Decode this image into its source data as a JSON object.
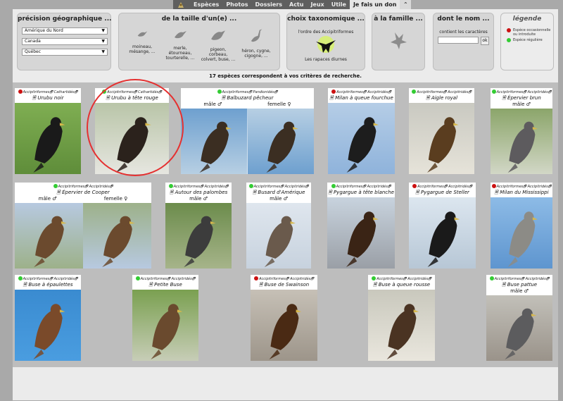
{
  "nav": {
    "items": [
      "Espèces",
      "Photos",
      "Dossiers",
      "Actu",
      "Jeux",
      "Utile",
      "Je fais un don"
    ],
    "collapse_glyph": "⌃"
  },
  "filters": {
    "geo": {
      "title": "précision géographique ...",
      "selects": [
        "Amérique du Nord",
        "Canada",
        "Québec"
      ]
    },
    "size": {
      "title": "de la taille d'un(e) ...",
      "options": [
        {
          "label": "moineau, mésange, ..."
        },
        {
          "label": "merle, étourneau, tourterelle, ..."
        },
        {
          "label": "pigeon, corbeau, colvert, buse, ..."
        },
        {
          "label": "héron, cygne, cigogne, ..."
        }
      ]
    },
    "taxo": {
      "title": "choix taxonomique ...",
      "line1": "l'ordre des Accipitriformes",
      "line2": "Les rapaces diurnes"
    },
    "family": {
      "title": "à la famille ..."
    },
    "name": {
      "title": "dont le nom ...",
      "label": "contient les caractères",
      "ok": "ok"
    },
    "legend": {
      "title": "légende",
      "items": [
        {
          "text": "Espèce occasionnelle ou introduite",
          "color": "#cc1111"
        },
        {
          "text": "Espèce régulière",
          "color": "#33cc33"
        }
      ]
    },
    "results": "17 espèces correspondent à vos critères de recherche."
  },
  "cards": [
    {
      "status": "#cc1111",
      "order": "Accipitriformes",
      "family": "Cathartidés",
      "name": "Urubu noir",
      "sex": ""
    },
    {
      "status": "#33cc33",
      "order": "Accipitriformes",
      "family": "Cathartidés",
      "name": "Urubu à tête rouge",
      "sex": ""
    },
    {
      "status": "#33cc33",
      "order": "Accipitriformes",
      "family": "Pandionidés",
      "name": "Balbuzard pêcheur",
      "sex_m": "mâle ♂",
      "sex_f": "femelle ♀"
    },
    {
      "status": "#cc1111",
      "order": "Accipitriformes",
      "family": "Accipitridés",
      "name": "Milan à queue fourchue",
      "sex": ""
    },
    {
      "status": "#33cc33",
      "order": "Accipitriformes",
      "family": "Accipitridés",
      "name": "Aigle royal",
      "sex": ""
    },
    {
      "status": "#33cc33",
      "order": "Accipitriformes",
      "family": "Accipitridés",
      "name": "Épervier brun",
      "sex": "mâle ♂"
    },
    {
      "status": "#33cc33",
      "order": "Accipitriformes",
      "family": "Accipitridés",
      "name": "Épervier de Cooper",
      "sex_m": "mâle ♂",
      "sex_f": "femelle ♀"
    },
    {
      "status": "#33cc33",
      "order": "Accipitriformes",
      "family": "Accipitridés",
      "name": "Autour des palombes",
      "sex": "mâle ♂"
    },
    {
      "status": "#33cc33",
      "order": "Accipitriformes",
      "family": "Accipitridés",
      "name": "Busard d'Amérique",
      "sex": "mâle ♂"
    },
    {
      "status": "#33cc33",
      "order": "Accipitriformes",
      "family": "Accipitridés",
      "name": "Pygargue à tête blanche",
      "sex": ""
    },
    {
      "status": "#cc1111",
      "order": "Accipitriformes",
      "family": "Accipitridés",
      "name": "Pygargue de Steller",
      "sex": ""
    },
    {
      "status": "#cc1111",
      "order": "Accipitriformes",
      "family": "Accipitridés",
      "name": "Milan du Mississippi",
      "sex": ""
    },
    {
      "status": "#33cc33",
      "order": "Accipitriformes",
      "family": "Accipitridés",
      "name": "Buse à épaulettes",
      "sex": ""
    },
    {
      "status": "#33cc33",
      "order": "Accipitriformes",
      "family": "Accipitridés",
      "name": "Petite Buse",
      "sex": ""
    },
    {
      "status": "#cc1111",
      "order": "Accipitriformes",
      "family": "Accipitridés",
      "name": "Buse de Swainson",
      "sex": ""
    },
    {
      "status": "#33cc33",
      "order": "Accipitriformes",
      "family": "Accipitridés",
      "name": "Buse à queue rousse",
      "sex": ""
    },
    {
      "status": "#33cc33",
      "order": "Accipitriformes",
      "family": "Accipitridés",
      "name": "Buse pattue",
      "sex": "mâle ♂"
    }
  ]
}
